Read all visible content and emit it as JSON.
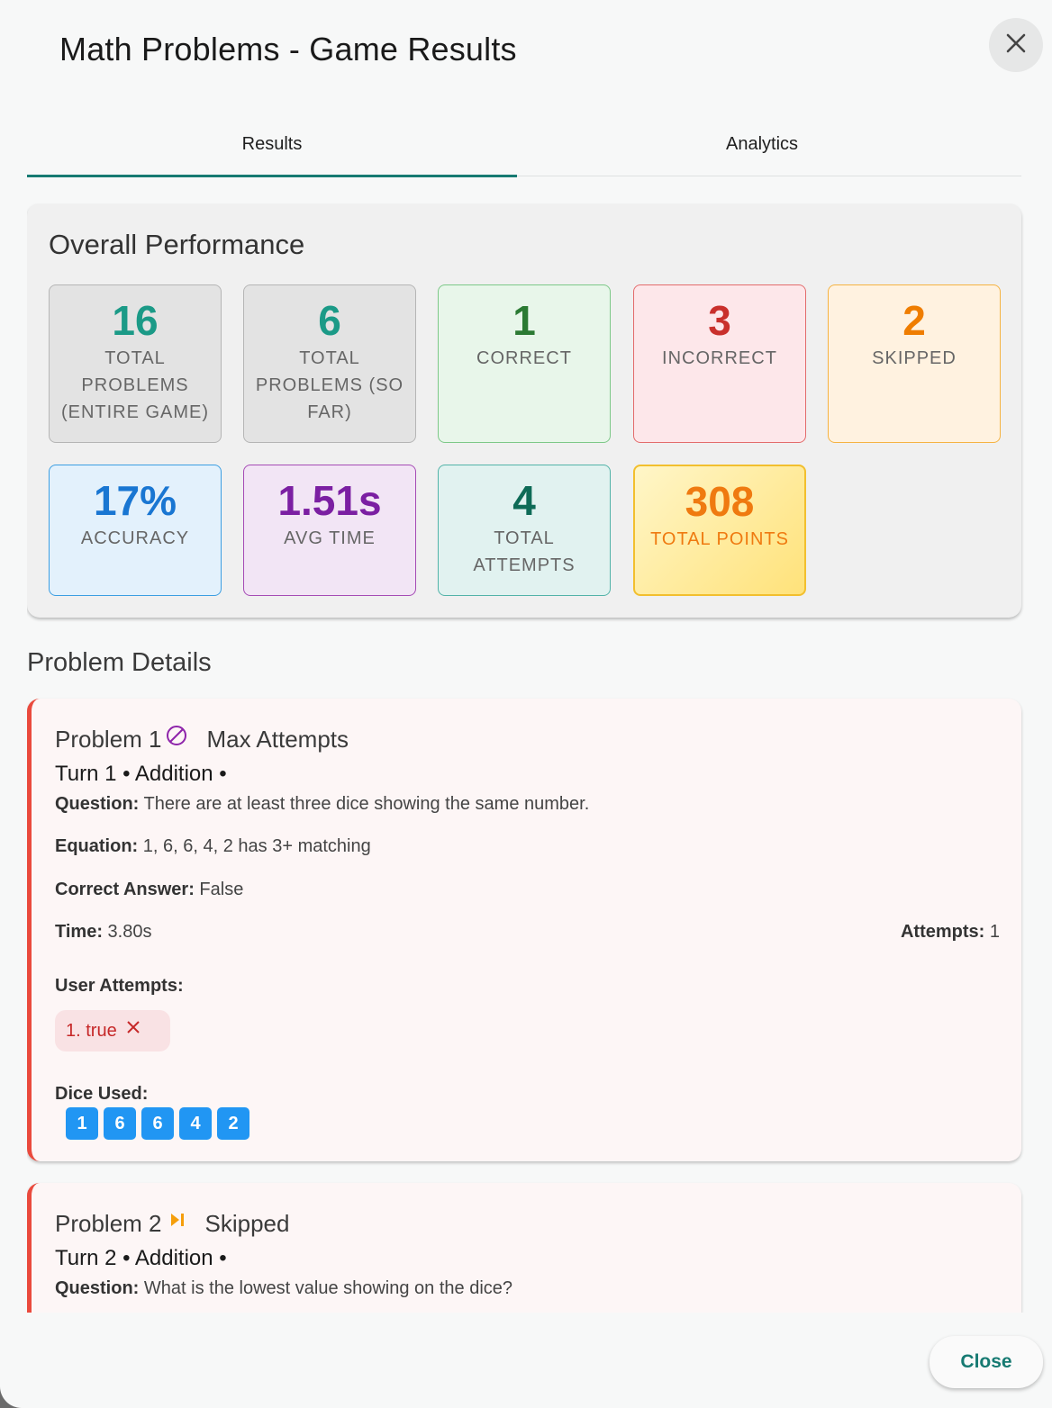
{
  "dialog": {
    "title": "Math Problems - Game Results",
    "close_icon": "close-icon",
    "close_button": "Close"
  },
  "tabs": [
    {
      "label": "Results",
      "active": true
    },
    {
      "label": "Analytics",
      "active": false
    }
  ],
  "overall": {
    "title": "Overall Performance",
    "stats": [
      {
        "value": "16",
        "label": "TOTAL PROBLEMS (ENTIRE GAME)",
        "color": "#1b9a87"
      },
      {
        "value": "6",
        "label": "TOTAL PROBLEMS (SO FAR)",
        "color": "#1b9a87"
      },
      {
        "value": "1",
        "label": "CORRECT",
        "color": "#2b7a33"
      },
      {
        "value": "3",
        "label": "INCORRECT",
        "color": "#c9302c"
      },
      {
        "value": "2",
        "label": "SKIPPED",
        "color": "#ef7d00"
      },
      {
        "value": "17%",
        "label": "ACCURACY",
        "color": "#1976d2"
      },
      {
        "value": "1.51s",
        "label": "AVG TIME",
        "color": "#7b1fa2"
      },
      {
        "value": "4",
        "label": "TOTAL ATTEMPTS",
        "color": "#0e6b57"
      },
      {
        "value": "308",
        "label": "TOTAL POINTS",
        "color": "#ef7a10"
      }
    ]
  },
  "details": {
    "title": "Problem Details",
    "problems": [
      {
        "title": "Problem 1",
        "status_icon": "prohibited-icon",
        "status": "Max Attempts",
        "turn": "Turn 1 • Addition •",
        "question_label": "Question:",
        "question": "There are at least three dice showing the same number.",
        "equation_label": "Equation:",
        "equation": "1, 6, 6, 4, 2 has 3+ matching",
        "answer_label": "Correct Answer:",
        "answer": "False",
        "time_label": "Time:",
        "time": "3.80s",
        "attempts_label": "Attempts:",
        "attempts": "1",
        "user_attempts_label": "User Attempts:",
        "user_attempts": [
          {
            "text": "1. true",
            "icon": "x-icon"
          }
        ],
        "dice_label": "Dice Used:",
        "dice": [
          "1",
          "6",
          "6",
          "4",
          "2"
        ]
      },
      {
        "title": "Problem 2",
        "status_icon": "skip-icon",
        "status": "Skipped",
        "turn": "Turn 2 • Addition •",
        "question_label": "Question:",
        "question": "What is the lowest value showing on the dice?"
      }
    ]
  },
  "colors": {
    "accent": "#167a72",
    "incorrect_border": "#ea4a3d",
    "die_blue": "#2196f3"
  }
}
